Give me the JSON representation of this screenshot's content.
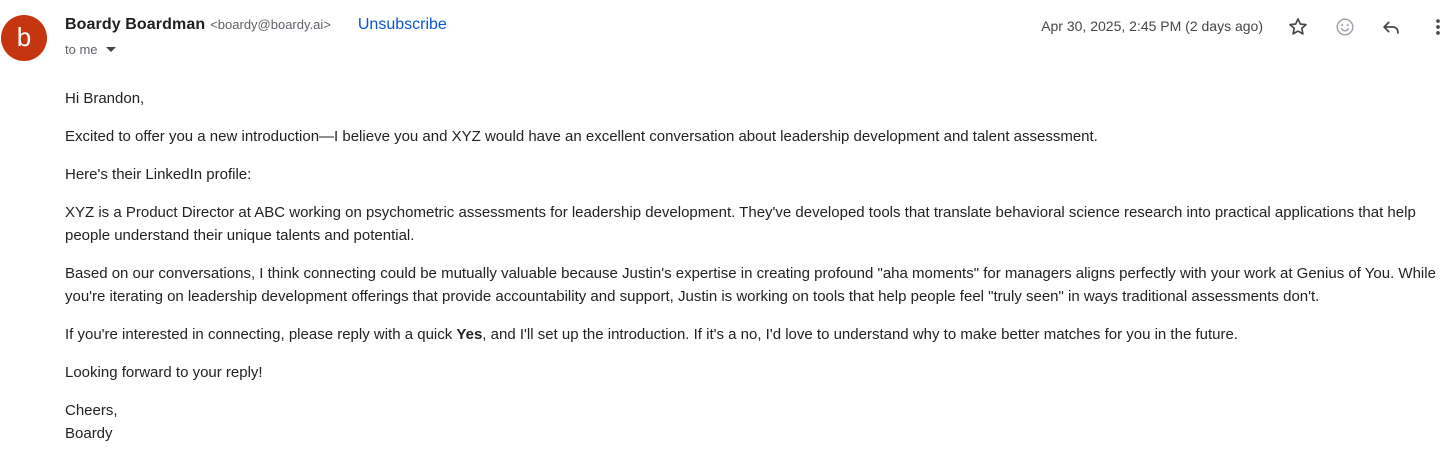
{
  "sender": {
    "avatar_letter": "b",
    "name": "Boardy Boardman",
    "email": "<boardy@boardy.ai>",
    "unsubscribe_label": "Unsubscribe",
    "to_label": "to me"
  },
  "meta": {
    "date": "Apr 30, 2025, 2:45 PM (2 days ago)"
  },
  "actions": {
    "star_icon": "star-icon",
    "emoji_icon": "emoji-icon",
    "reply_icon": "reply-icon",
    "more_icon": "more-vert-icon"
  },
  "colors": {
    "avatar": "#c5350f",
    "link": "#0b57d0"
  },
  "message": {
    "greeting": "Hi Brandon,",
    "p1": "Excited to offer you a new introduction—I believe you and XYZ would have an excellent conversation about leadership development and talent assessment.",
    "p2": "Here's their LinkedIn profile:",
    "p3": "XYZ is a Product Director at ABC working on psychometric assessments for leadership development. They've developed tools that translate behavioral science research into practical applications that help people understand their unique talents and potential.",
    "p4": "Based on our conversations, I think connecting could be mutually valuable because Justin's expertise in creating profound \"aha moments\" for managers aligns perfectly with your work at Genius of You. While you're iterating on leadership development offerings that provide accountability and support, Justin is working on tools that help people feel \"truly seen\" in ways traditional assessments don't.",
    "p5_before": "If you're interested in connecting, please reply with a quick ",
    "p5_bold": "Yes",
    "p5_after": ", and I'll set up the introduction. If it's a no, I'd love to understand why to make better matches for you in the future.",
    "p6": "Looking forward to your reply!",
    "signoff": "Cheers,",
    "signature": "Boardy"
  }
}
